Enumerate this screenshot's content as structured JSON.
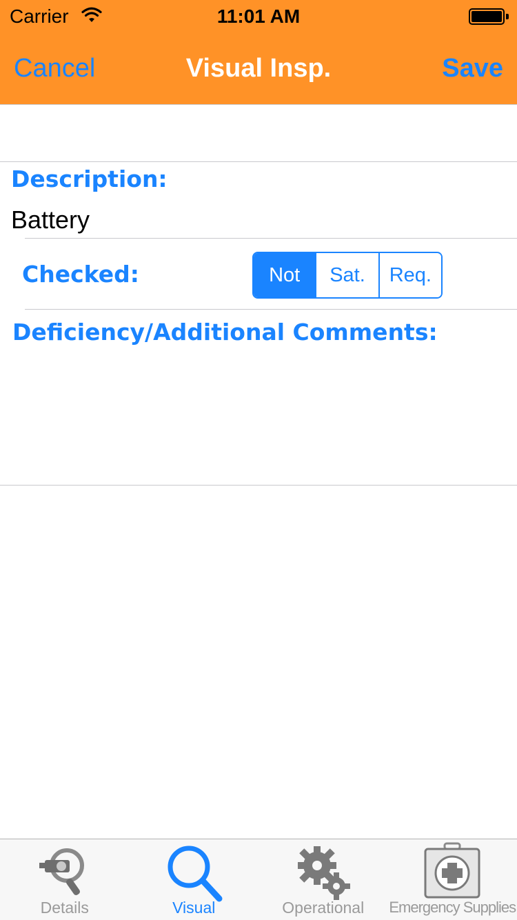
{
  "status_bar": {
    "carrier": "Carrier",
    "time": "11:01 AM"
  },
  "nav": {
    "cancel_label": "Cancel",
    "title": "Visual Insp.",
    "save_label": "Save"
  },
  "form": {
    "description_label": "Description:",
    "description_value": "Battery",
    "checked_label": "Checked:",
    "checked_options": [
      "Not",
      "Sat.",
      "Req."
    ],
    "checked_selected": "Not",
    "comments_label": "Deficiency/Additional Comments:",
    "comments_value": ""
  },
  "tabs": [
    {
      "label": "Details",
      "icon": "details-inspection-icon",
      "active": false
    },
    {
      "label": "Visual",
      "icon": "magnifier-icon",
      "active": true
    },
    {
      "label": "Operational",
      "icon": "gears-icon",
      "active": false
    },
    {
      "label": "Emergency Supplies",
      "icon": "first-aid-kit-icon",
      "active": false
    }
  ],
  "colors": {
    "nav_bar": "#ff9227",
    "accent": "#1a84ff",
    "tab_inactive": "#9a9a9a"
  }
}
